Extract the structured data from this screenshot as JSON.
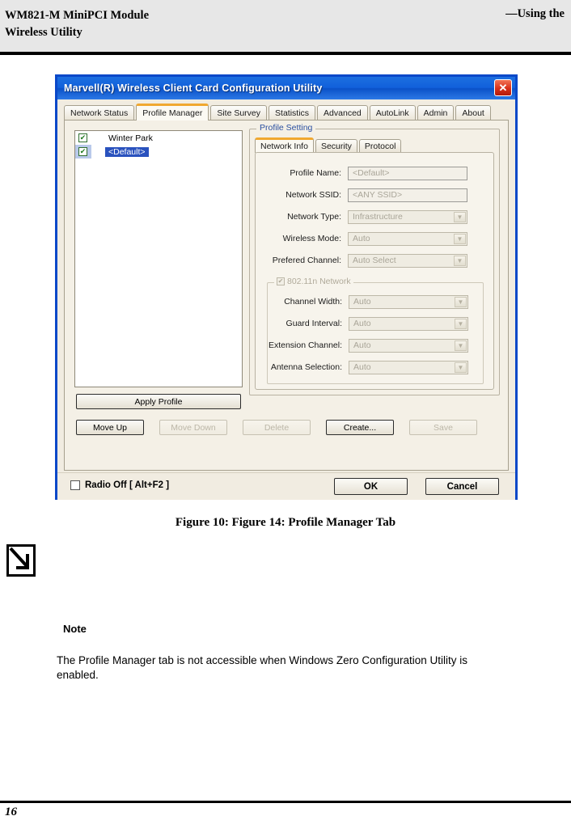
{
  "page": {
    "header_left": "WM821-M MiniPCI Module",
    "header_left2": "Wireless Utility",
    "header_right": "—Using the",
    "figure_caption": "Figure 10: Figure 14: Profile Manager Tab",
    "page_number": "16",
    "note_icon": "down-right-arrow-icon"
  },
  "note": {
    "title": "Note",
    "body": "The Profile Manager tab is not accessible when Windows Zero Configuration Utility is enabled."
  },
  "dialog": {
    "title": "Marvell(R) Wireless Client Card Configuration Utility",
    "close_icon": "close-icon",
    "tabs": [
      {
        "label": "Network Status",
        "active": false
      },
      {
        "label": "Profile Manager",
        "active": true
      },
      {
        "label": "Site Survey",
        "active": false
      },
      {
        "label": "Statistics",
        "active": false
      },
      {
        "label": "Advanced",
        "active": false
      },
      {
        "label": "AutoLink",
        "active": false
      },
      {
        "label": "Admin",
        "active": false
      },
      {
        "label": "About",
        "active": false
      }
    ],
    "profile_list": [
      {
        "name": "Winter Park",
        "checked": true,
        "selected": false
      },
      {
        "name": "<Default>",
        "checked": true,
        "selected": true
      }
    ],
    "apply_profile_label": "Apply Profile",
    "profile_setting": {
      "legend": "Profile Setting",
      "inner_tabs": [
        {
          "label": "Network Info",
          "active": true
        },
        {
          "label": "Security",
          "active": false
        },
        {
          "label": "Protocol",
          "active": false
        }
      ],
      "fields": [
        {
          "label": "Profile Name:",
          "value": "<Default>",
          "kind": "text"
        },
        {
          "label": "Network SSID:",
          "value": "<ANY SSID>",
          "kind": "text"
        },
        {
          "label": "Network Type:",
          "value": "Infrastructure",
          "kind": "select"
        },
        {
          "label": "Wireless Mode:",
          "value": "Auto",
          "kind": "select"
        },
        {
          "label": "Prefered Channel:",
          "value": "Auto Select",
          "kind": "select"
        }
      ],
      "n_group": {
        "legend": "802.11n Network",
        "checked": true,
        "fields": [
          {
            "label": "Channel Width:",
            "value": "Auto",
            "kind": "select"
          },
          {
            "label": "Guard Interval:",
            "value": "Auto",
            "kind": "select"
          },
          {
            "label": "Extension Channel:",
            "value": "Auto",
            "kind": "select"
          },
          {
            "label": "Antenna Selection:",
            "value": "Auto",
            "kind": "select"
          }
        ]
      }
    },
    "action_buttons": [
      {
        "label": "Move Up",
        "enabled": true
      },
      {
        "label": "Move Down",
        "enabled": false
      },
      {
        "label": "Delete",
        "enabled": false
      },
      {
        "label": "Create...",
        "enabled": true
      },
      {
        "label": "Save",
        "enabled": false
      }
    ],
    "radio_off_label": "Radio Off  [ Alt+F2 ]",
    "radio_off_checked": false,
    "ok_label": "OK",
    "cancel_label": "Cancel"
  },
  "colors": {
    "titlebar_blue": "#1160db",
    "dialog_border": "#0a48c8",
    "active_tab_accent": "#f0a830",
    "selection_blue": "#2a52be",
    "close_red": "#d8301a",
    "legend_blue": "#2a4fa0"
  }
}
